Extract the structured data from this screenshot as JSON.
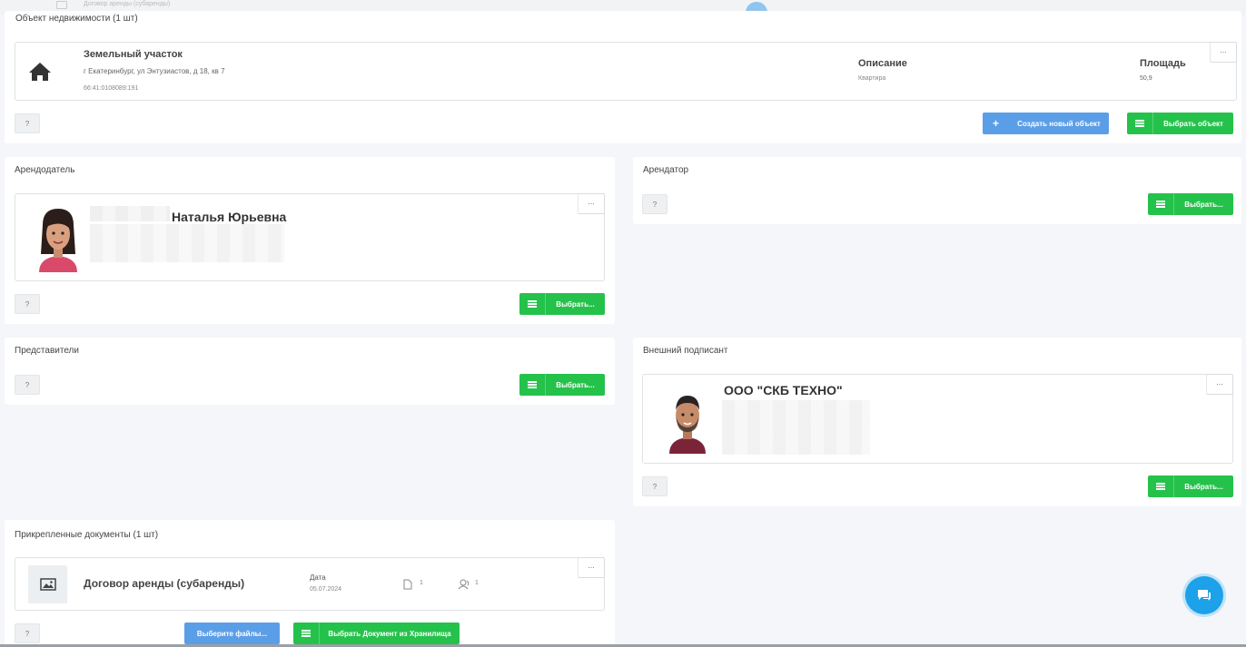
{
  "top_strip": {
    "doc_title": "Договор аренды (субаренды)"
  },
  "property": {
    "section_title": "Объект недвижимости (1 шт)",
    "name": "Земельный участок",
    "address": "г Екатеринбург, ул Энтузиастов, д 18, кв 7",
    "cadastral": "66:41:0108089:191",
    "description_label": "Описание",
    "description_value": "Квартира",
    "area_label": "Площадь",
    "area_value": "50,9",
    "more": "...",
    "help": "?",
    "create_btn": "Создать новый объект",
    "select_btn": "Выбрать объект"
  },
  "landlord": {
    "section_title": "Арендодатель",
    "name": "Наталья Юрьевна",
    "more": "...",
    "help": "?",
    "select_btn": "Выбрать..."
  },
  "tenant": {
    "section_title": "Арендатор",
    "help": "?",
    "select_btn": "Выбрать..."
  },
  "representatives": {
    "section_title": "Представители",
    "help": "?",
    "select_btn": "Выбрать..."
  },
  "signer": {
    "section_title": "Внешний подписант",
    "name": "ООО \"СКБ ТЕХНО\"",
    "more": "...",
    "help": "?",
    "select_btn": "Выбрать..."
  },
  "documents": {
    "section_title": "Прикрепленные документы (1 шт)",
    "doc_name": "Договор аренды (субаренды)",
    "date_label": "Дата",
    "date_value": "05.07.2024",
    "files_count": "1",
    "signers_count": "1",
    "more": "...",
    "help": "?",
    "choose_files_btn": "Выберите файлы...",
    "choose_storage_btn": "Выбрать Документ из Хранилища"
  },
  "colors": {
    "green": "#25c24b",
    "blue": "#5b9ee8",
    "chat": "#1da1e8"
  }
}
